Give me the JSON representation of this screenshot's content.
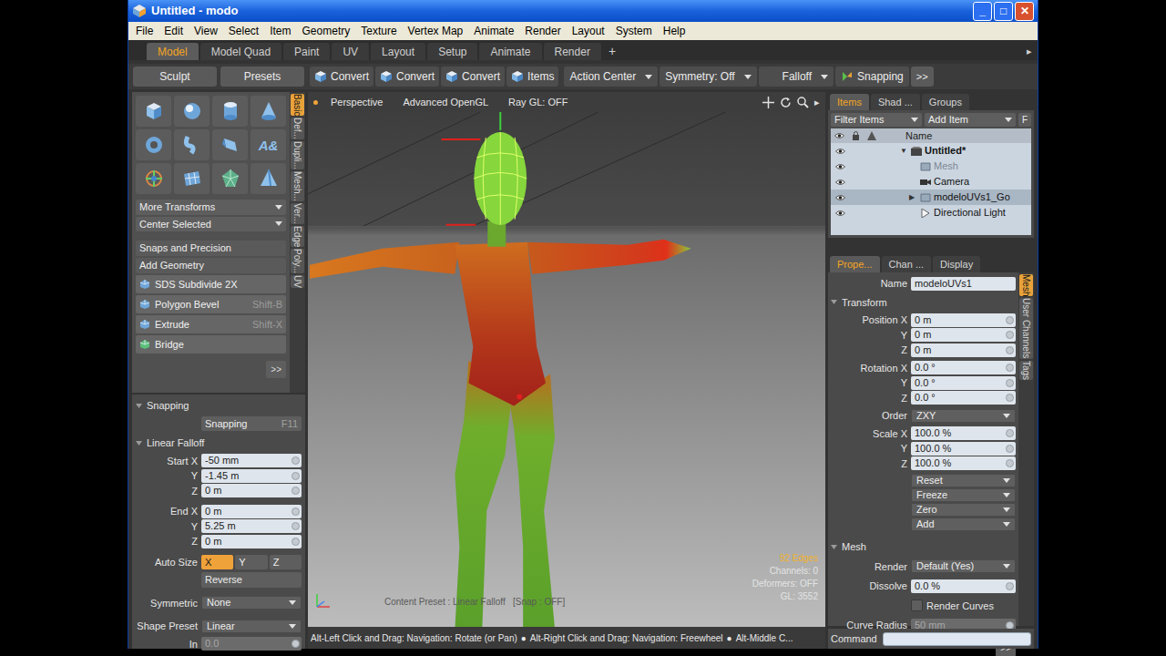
{
  "window": {
    "title": "Untitled - modo",
    "controls": [
      "_",
      "□",
      "✕"
    ]
  },
  "menu": [
    "File",
    "Edit",
    "View",
    "Select",
    "Item",
    "Geometry",
    "Texture",
    "Vertex Map",
    "Animate",
    "Render",
    "Layout",
    "System",
    "Help"
  ],
  "layout_tabs": [
    {
      "label": "Model",
      "selected": true
    },
    {
      "label": "Model Quad",
      "selected": false
    },
    {
      "label": "Paint",
      "selected": false
    },
    {
      "label": "UV",
      "selected": false
    },
    {
      "label": "Layout",
      "selected": false
    },
    {
      "label": "Setup",
      "selected": false
    },
    {
      "label": "Animate",
      "selected": false
    },
    {
      "label": "Render",
      "selected": false
    }
  ],
  "add_tab": "+",
  "tab_scroll": "▸",
  "toolbar": {
    "palette_buttons": [
      "Sculpt",
      "Presets"
    ],
    "buttons": [
      "Convert",
      "Convert",
      "Convert",
      "Items"
    ],
    "dropdowns": [
      "Action Center",
      "Symmetry: Off",
      "Falloff"
    ],
    "snapping": "Snapping",
    "more": ">>"
  },
  "tool_panel": {
    "text_tool_glyph": "A&",
    "rows": [
      {
        "kind": "dropdown",
        "label": "More Transforms",
        "shortcut": ""
      },
      {
        "kind": "dropdown",
        "label": "Center Selected",
        "shortcut": ""
      },
      {
        "kind": "header",
        "label": "Snaps and Precision",
        "shortcut": ""
      },
      {
        "kind": "header",
        "label": "Add Geometry",
        "shortcut": ""
      },
      {
        "kind": "tool",
        "label": "SDS Subdivide 2X",
        "shortcut": ""
      },
      {
        "kind": "tool",
        "label": "Polygon Bevel",
        "shortcut": "Shift-B"
      },
      {
        "kind": "tool",
        "label": "Extrude",
        "shortcut": "Shift-X"
      },
      {
        "kind": "tool",
        "label": "Bridge",
        "shortcut": ""
      }
    ],
    "more": ">>",
    "side_tabs": [
      {
        "label": "Basic",
        "selected": true
      },
      {
        "label": "Def...",
        "selected": false
      },
      {
        "label": "Dupli...",
        "selected": false
      },
      {
        "label": "Mesh...",
        "selected": false
      },
      {
        "label": "Ver...",
        "selected": false
      },
      {
        "label": "Edge",
        "selected": false
      },
      {
        "label": "Poly...",
        "selected": false
      },
      {
        "label": "UV",
        "selected": false
      }
    ]
  },
  "snapping_panel": {
    "title": "Snapping",
    "button": "Snapping",
    "shortcut": "F11"
  },
  "linear_falloff": {
    "title": "Linear Falloff",
    "vectors": [
      {
        "label": "Start",
        "fields": [
          {
            "axis": "X",
            "value": "-50 mm"
          },
          {
            "axis": "Y",
            "value": "-1.45 m"
          },
          {
            "axis": "Z",
            "value": "0 m"
          }
        ]
      },
      {
        "label": "End",
        "fields": [
          {
            "axis": "X",
            "value": "0 m"
          },
          {
            "axis": "Y",
            "value": "5.25 m"
          },
          {
            "axis": "Z",
            "value": "0 m"
          }
        ]
      }
    ],
    "auto_size": {
      "label": "Auto Size",
      "axes": [
        {
          "label": "X",
          "selected": true
        },
        {
          "label": "Y",
          "selected": false
        },
        {
          "label": "Z",
          "selected": false
        }
      ]
    },
    "reverse": "Reverse",
    "dropdowns": [
      {
        "label": "Symmetric",
        "value": "None"
      },
      {
        "label": "Shape Preset",
        "value": "Linear"
      }
    ],
    "in": {
      "label": "In",
      "value": "0.0",
      "disabled": true
    },
    "more": ">>"
  },
  "viewport": {
    "view": "Perspective",
    "shading": "Advanced OpenGL",
    "raygl": "Ray GL: OFF",
    "nav_arrow": "▸",
    "stats": [
      {
        "text": "92 Edges",
        "highlight": true
      },
      {
        "text": "Channels: 0",
        "highlight": false
      },
      {
        "text": "Deformers: OFF",
        "highlight": false
      },
      {
        "text": "GL: 3552",
        "highlight": false
      }
    ],
    "preset_line": "Content Preset : Linear Falloff   [Snap : OFF]"
  },
  "status": {
    "hints": [
      "Alt-Left Click and Drag: Navigation: Rotate (or Pan)",
      "Alt-Right Click and Drag: Navigation: Freewheel",
      "Alt-Middle C..."
    ],
    "separator": "●",
    "command_label": "Command"
  },
  "items_panel": {
    "tabs": [
      {
        "label": "Items",
        "selected": true
      },
      {
        "label": "Shad ...",
        "selected": false
      },
      {
        "label": "Groups",
        "selected": false
      }
    ],
    "filter": "Filter Items",
    "add": "Add Item",
    "f": "F",
    "column": "Name",
    "tree": [
      {
        "label": "Untitled*",
        "depth": 0,
        "kind": "scene",
        "toggle": "▼",
        "disabled": false,
        "selected": false
      },
      {
        "label": "Mesh",
        "depth": 1,
        "kind": "mesh",
        "toggle": "",
        "disabled": true,
        "selected": false
      },
      {
        "label": "Camera",
        "depth": 1,
        "kind": "camera",
        "toggle": "",
        "disabled": false,
        "selected": false
      },
      {
        "label": "modeloUVs1_Go",
        "depth": 1,
        "kind": "mesh",
        "toggle": "▶",
        "disabled": false,
        "selected": true
      },
      {
        "label": "Directional Light",
        "depth": 1,
        "kind": "light",
        "toggle": "",
        "disabled": false,
        "selected": false
      }
    ]
  },
  "properties": {
    "tabs": [
      {
        "label": "Prope...",
        "selected": true
      },
      {
        "label": "Chan ...",
        "selected": false
      },
      {
        "label": "Display",
        "selected": false
      }
    ],
    "name": {
      "label": "Name",
      "value": "modeloUVs1"
    },
    "transform": {
      "title": "Transform",
      "rows": [
        {
          "kind": "vector",
          "label": "Position",
          "fields": [
            {
              "axis": "X",
              "value": "0 m"
            },
            {
              "axis": "Y",
              "value": "0 m"
            },
            {
              "axis": "Z",
              "value": "0 m"
            }
          ]
        },
        {
          "kind": "vector",
          "label": "Rotation",
          "fields": [
            {
              "axis": "X",
              "value": "0.0 °"
            },
            {
              "axis": "Y",
              "value": "0.0 °"
            },
            {
              "axis": "Z",
              "value": "0.0 °"
            }
          ]
        },
        {
          "kind": "dropdown",
          "label": "Order",
          "value": "ZXY"
        },
        {
          "kind": "vector",
          "label": "Scale",
          "fields": [
            {
              "axis": "X",
              "value": "100.0 %"
            },
            {
              "axis": "Y",
              "value": "100.0 %"
            },
            {
              "axis": "Z",
              "value": "100.0 %"
            }
          ]
        }
      ],
      "actions": [
        "Reset",
        "Freeze",
        "Zero",
        "Add"
      ]
    },
    "mesh": {
      "title": "Mesh",
      "render": {
        "label": "Render",
        "value": "Default (Yes)"
      },
      "dissolve": {
        "label": "Dissolve",
        "value": "0.0 %"
      },
      "render_curves": {
        "label": "Render Curves",
        "checked": false
      },
      "curve_radius": {
        "label": "Curve Radius",
        "value": "50 mm",
        "disabled": true
      }
    },
    "more": ">>",
    "side_tabs": [
      {
        "label": "Mesh",
        "selected": true
      },
      {
        "label": "User Channels",
        "selected": false
      },
      {
        "label": "Tags",
        "selected": false
      }
    ]
  }
}
